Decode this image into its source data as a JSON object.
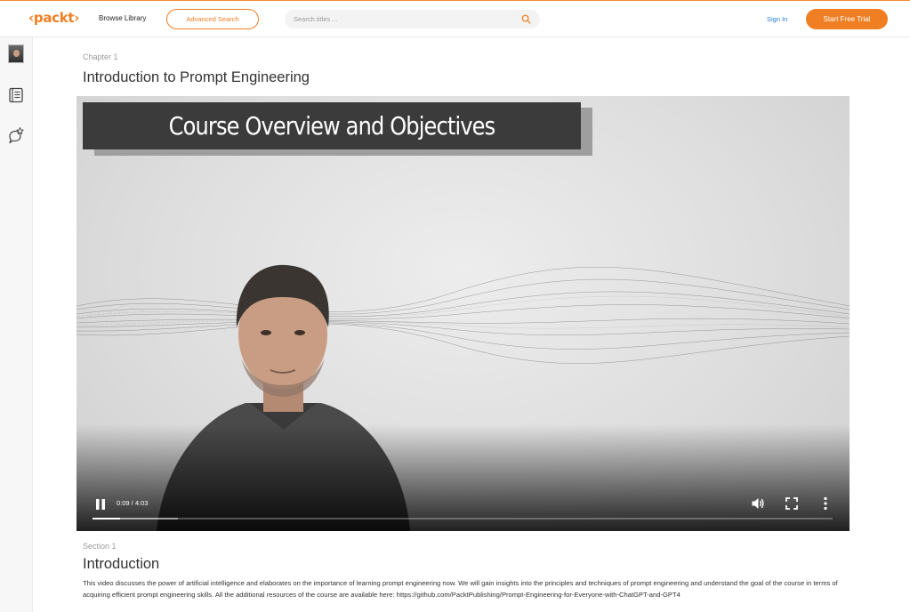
{
  "header": {
    "logo": "‹packt›",
    "browse_library": "Browse Library",
    "advanced_search": "Advanced Search",
    "search_placeholder": "Search titles ...",
    "sign_in": "Sign In",
    "start_trial": "Start Free Trial",
    "accent_color": "#f07f23",
    "sign_in_color": "#2a7fd0"
  },
  "sidebar": {
    "items": [
      {
        "icon": "course-thumbnail"
      },
      {
        "icon": "table-of-contents-icon"
      },
      {
        "icon": "chat-star-icon"
      }
    ]
  },
  "content": {
    "chapter": "Chapter 1",
    "title": "Introduction to Prompt Engineering"
  },
  "video": {
    "overlay_title": "Course Overview and Objectives",
    "time": "0:09 / 4:03",
    "progress_fraction": 0.037,
    "buffered_fraction": 0.115
  },
  "section": {
    "label": "Section 1",
    "title": "Introduction",
    "description": "This video discusses the power of artificial intelligence and elaborates on the importance of learning prompt engineering now. We will gain insights into the principles and techniques of prompt engineering and understand the goal of the course in terms of acquiring efficient prompt engineering skills. All the additional resources of the course are available here: https://github.com/PacktPublishing/Prompt-Engineering-for-Everyone-with-ChatGPT-and-GPT4"
  }
}
